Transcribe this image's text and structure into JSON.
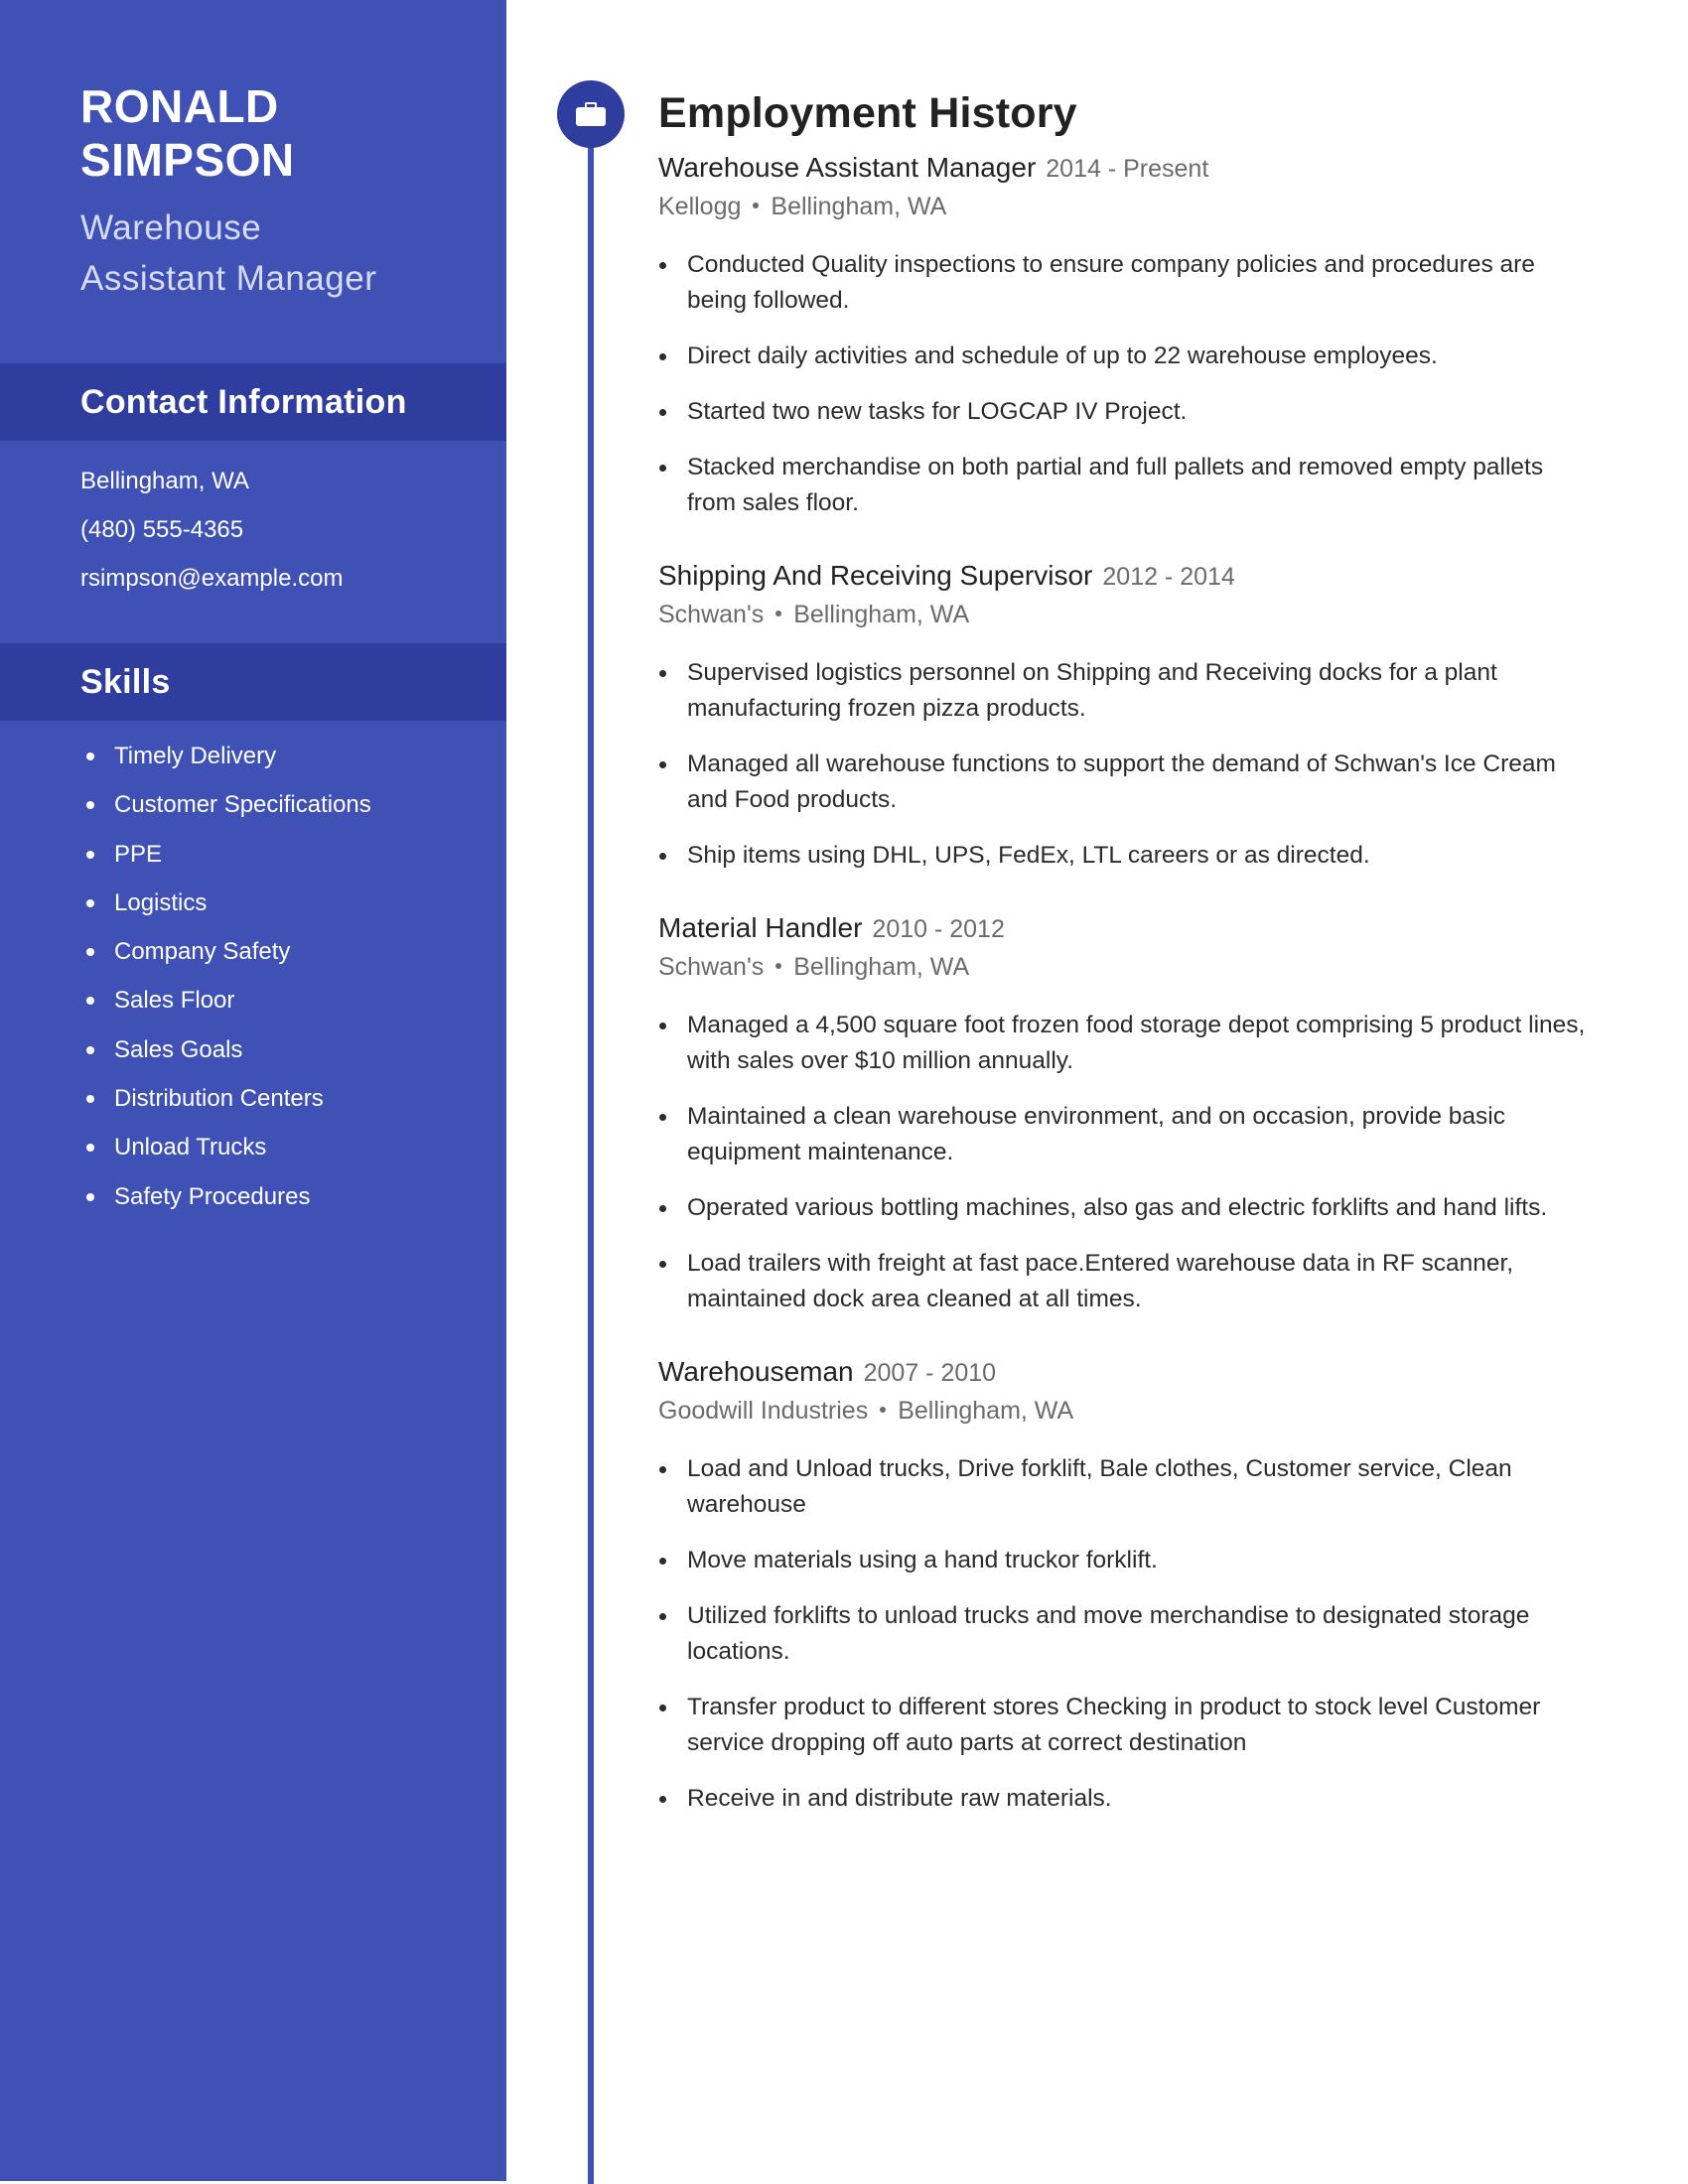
{
  "profile": {
    "name_line1": "RONALD",
    "name_line2": "SIMPSON",
    "title_line1": "Warehouse",
    "title_line2": "Assistant Manager"
  },
  "contact": {
    "heading": "Contact Information",
    "location": "Bellingham, WA",
    "phone": "(480) 555-4365",
    "email": "rsimpson@example.com"
  },
  "skills": {
    "heading": "Skills",
    "items": [
      "Timely Delivery",
      "Customer Specifications",
      "PPE",
      "Logistics",
      "Company Safety",
      "Sales Floor",
      "Sales Goals",
      "Distribution Centers",
      "Unload Trucks",
      "Safety Procedures"
    ]
  },
  "employment": {
    "heading": "Employment History",
    "icon": "briefcase-icon",
    "jobs": [
      {
        "title": "Warehouse Assistant Manager",
        "dates": "2014 - Present",
        "company": "Kellogg",
        "location": "Bellingham, WA",
        "bullets": [
          "Conducted Quality inspections to ensure company policies and procedures are being followed.",
          "Direct daily activities and schedule of up to 22 warehouse employees.",
          "Started two new tasks for LOGCAP IV Project.",
          "Stacked merchandise on both partial and full pallets and removed empty pallets from sales floor."
        ]
      },
      {
        "title": "Shipping And Receiving Supervisor",
        "dates": "2012 - 2014",
        "company": "Schwan's",
        "location": "Bellingham, WA",
        "bullets": [
          "Supervised logistics personnel on Shipping and Receiving docks for a plant manufacturing frozen pizza products.",
          "Managed all warehouse functions to support the demand of Schwan's Ice Cream and Food products.",
          "Ship items using DHL, UPS, FedEx, LTL careers or as directed."
        ]
      },
      {
        "title": "Material Handler",
        "dates": "2010 - 2012",
        "company": "Schwan's",
        "location": "Bellingham, WA",
        "bullets": [
          "Managed a 4,500 square foot frozen food storage depot comprising 5 product lines, with sales over $10 million annually.",
          "Maintained a clean warehouse environment, and on occasion, provide basic equipment maintenance.",
          "Operated various bottling machines, also gas and electric forklifts and hand lifts.",
          "Load trailers with freight at fast pace.Entered warehouse data in RF scanner, maintained dock area cleaned at all times."
        ]
      },
      {
        "title": "Warehouseman",
        "dates": "2007 - 2010",
        "company": "Goodwill Industries",
        "location": "Bellingham, WA",
        "bullets": [
          "Load and Unload trucks, Drive forklift, Bale clothes, Customer service, Clean warehouse",
          "Move materials using a hand truckor forklift.",
          "Utilized forklifts to unload trucks and move merchandise to designated storage locations.",
          "Transfer product to different stores Checking in product to stock level Customer service dropping off auto parts at correct destination",
          "Receive in and distribute raw materials."
        ]
      }
    ]
  },
  "colors": {
    "sidebar": "#3f51b5",
    "sidebar_band": "#2f3d9e",
    "text_dark": "#222222",
    "text_muted": "#6b6b6b"
  }
}
